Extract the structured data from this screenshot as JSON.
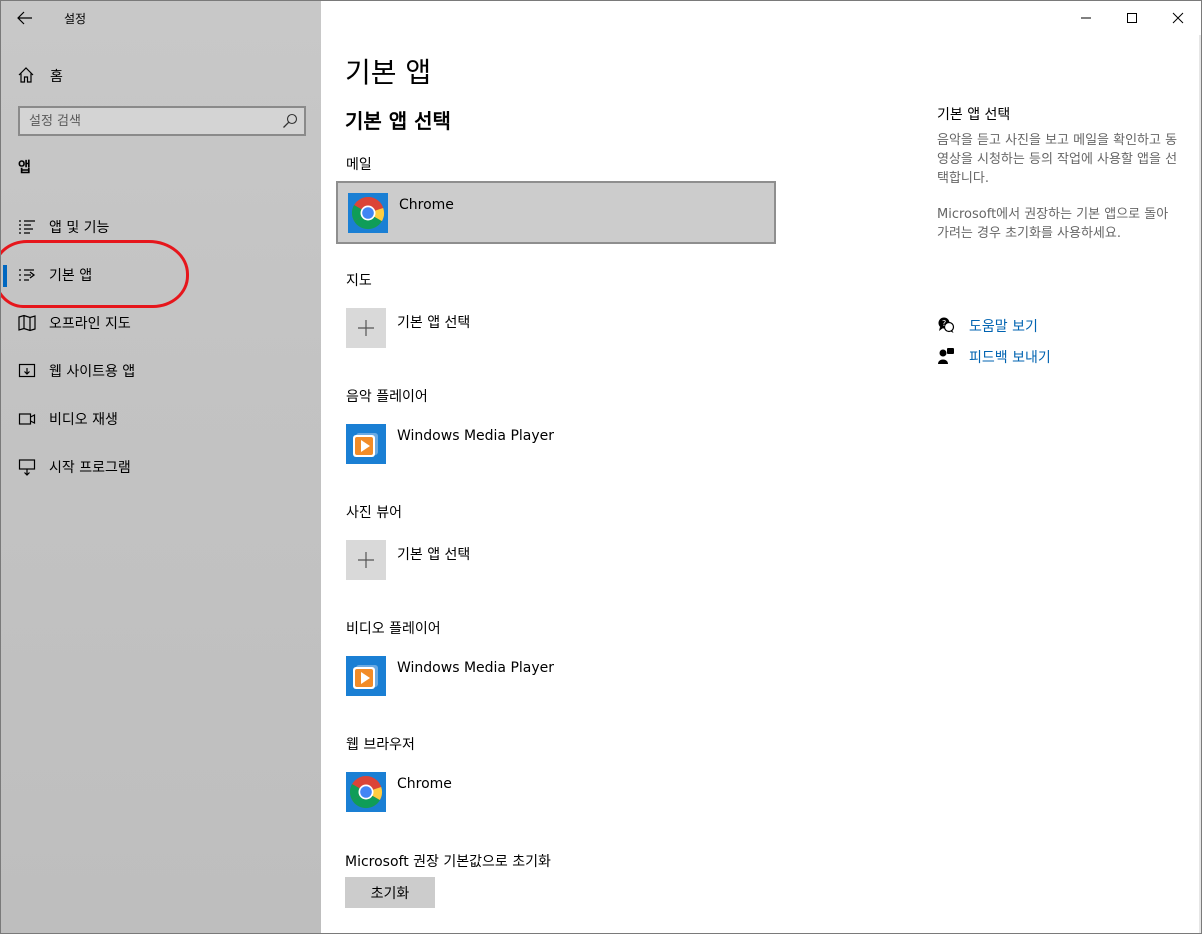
{
  "window": {
    "title": "설정",
    "controls": {
      "minimize": "minimize",
      "maximize": "maximize",
      "close": "close"
    }
  },
  "sidebar": {
    "home_label": "홈",
    "search_placeholder": "설정 검색",
    "section_title": "앱",
    "items": [
      {
        "label": "앱 및 기능",
        "icon": "apps-features-icon",
        "active": false
      },
      {
        "label": "기본 앱",
        "icon": "default-apps-icon",
        "active": true
      },
      {
        "label": "오프라인 지도",
        "icon": "offline-maps-icon",
        "active": false
      },
      {
        "label": "웹 사이트용 앱",
        "icon": "apps-for-websites-icon",
        "active": false
      },
      {
        "label": "비디오 재생",
        "icon": "video-playback-icon",
        "active": false
      },
      {
        "label": "시작 프로그램",
        "icon": "startup-icon",
        "active": false
      }
    ]
  },
  "main": {
    "page_title": "기본 앱",
    "subtitle": "기본 앱 선택",
    "categories": [
      {
        "label": "메일",
        "app": "Chrome",
        "icon": "chrome-icon"
      },
      {
        "label": "지도",
        "app": "기본 앱 선택",
        "icon": "plus-icon"
      },
      {
        "label": "음악 플레이어",
        "app": "Windows Media Player",
        "icon": "windows-media-player-icon"
      },
      {
        "label": "사진 뷰어",
        "app": "기본 앱 선택",
        "icon": "plus-icon"
      },
      {
        "label": "비디오 플레이어",
        "app": "Windows Media Player",
        "icon": "windows-media-player-icon"
      },
      {
        "label": "웹 브라우저",
        "app": "Chrome",
        "icon": "chrome-icon"
      }
    ],
    "reset_label": "Microsoft 권장 기본값으로 초기화",
    "reset_button": "초기화"
  },
  "side_panel": {
    "title": "기본 앱 선택",
    "description": "음악을 듣고 사진을 보고 메일을 확인하고 동영상을 시청하는 등의 작업에 사용할 앱을 선택합니다.",
    "description2": "Microsoft에서 권장하는 기본 앱으로 돌아가려는 경우 초기화를 사용하세요.",
    "help_link": "도움말 보기",
    "feedback_link": "피드백 보내기"
  },
  "colors": {
    "sidebar_bg": "#c4c4c4",
    "accent": "#0067c0",
    "link": "#0063b1",
    "annotation": "#e6161c",
    "selected_tile": "#cccccc"
  }
}
